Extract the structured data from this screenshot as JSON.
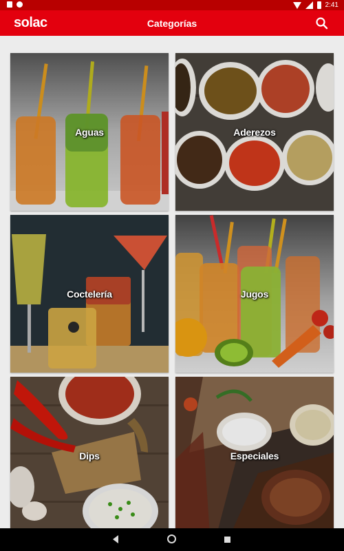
{
  "status_bar": {
    "time": "2:41"
  },
  "app_bar": {
    "logo": "solac",
    "title": "Categorías",
    "search_icon": "search-icon"
  },
  "colors": {
    "brand": "#e3000e",
    "status_bar": "#b80000",
    "background": "#ececec"
  },
  "categories": [
    {
      "label": "Aguas"
    },
    {
      "label": "Aderezos"
    },
    {
      "label": "Coctelería"
    },
    {
      "label": "Jugos"
    },
    {
      "label": "Dips"
    },
    {
      "label": "Especiales"
    }
  ],
  "nav": {
    "back_icon": "back-icon",
    "home_icon": "home-icon",
    "recents_icon": "recents-icon"
  }
}
